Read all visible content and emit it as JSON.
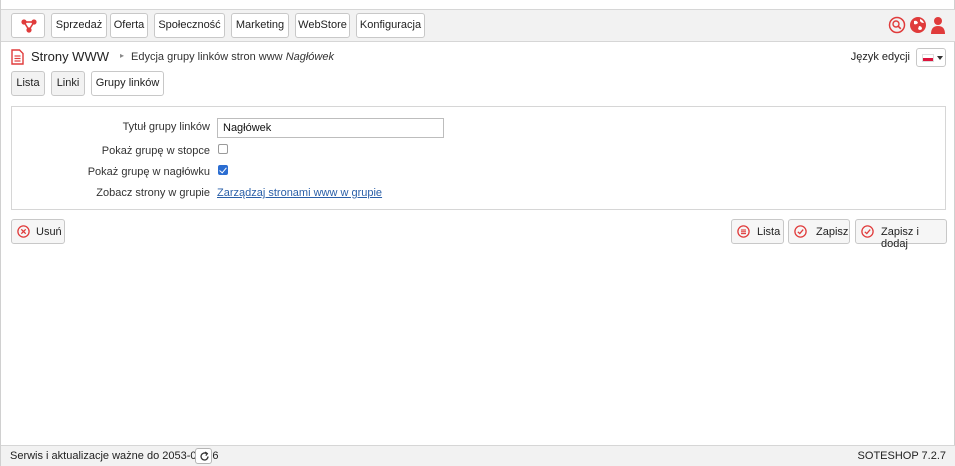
{
  "colors": {
    "accent": "#e03b3b",
    "link": "#2a5fa8",
    "checkbox": "#2b6dd1"
  },
  "nav": {
    "logo_icon": "soteshop-logo-icon",
    "items": [
      "Sprzedaż",
      "Oferta",
      "Społeczność",
      "Marketing",
      "WebStore",
      "Konfiguracja"
    ],
    "icons": [
      "search-icon",
      "globe-icon",
      "user-icon"
    ]
  },
  "header": {
    "icon": "document-icon",
    "title": "Strony WWW",
    "separator": "▸",
    "breadcrumb_prefix": "Edycja grupy linków stron www",
    "breadcrumb_item": "Nagłówek",
    "language_label": "Język edycji",
    "language_flag": "pl-flag-icon"
  },
  "tabs": [
    {
      "label": "Lista",
      "active": false
    },
    {
      "label": "Linki",
      "active": false
    },
    {
      "label": "Grupy linków",
      "active": true
    }
  ],
  "form": {
    "title_label": "Tytuł grupy linków",
    "title_value": "Nagłówek",
    "footer_label": "Pokaż grupę w stopce",
    "footer_checked": false,
    "header_label": "Pokaż grupę w nagłówku",
    "header_checked": true,
    "pages_label": "Zobacz strony w grupie",
    "pages_link": "Zarządzaj stronami www w grupie"
  },
  "actions": {
    "delete": "Usuń",
    "list": "Lista",
    "save": "Zapisz",
    "save_add": "Zapisz i dodaj"
  },
  "footer": {
    "service_text": "Serwis i aktualizacje ważne do 2053-08-26",
    "refresh_icon": "refresh-icon",
    "version": "SOTESHOP 7.2.7"
  }
}
